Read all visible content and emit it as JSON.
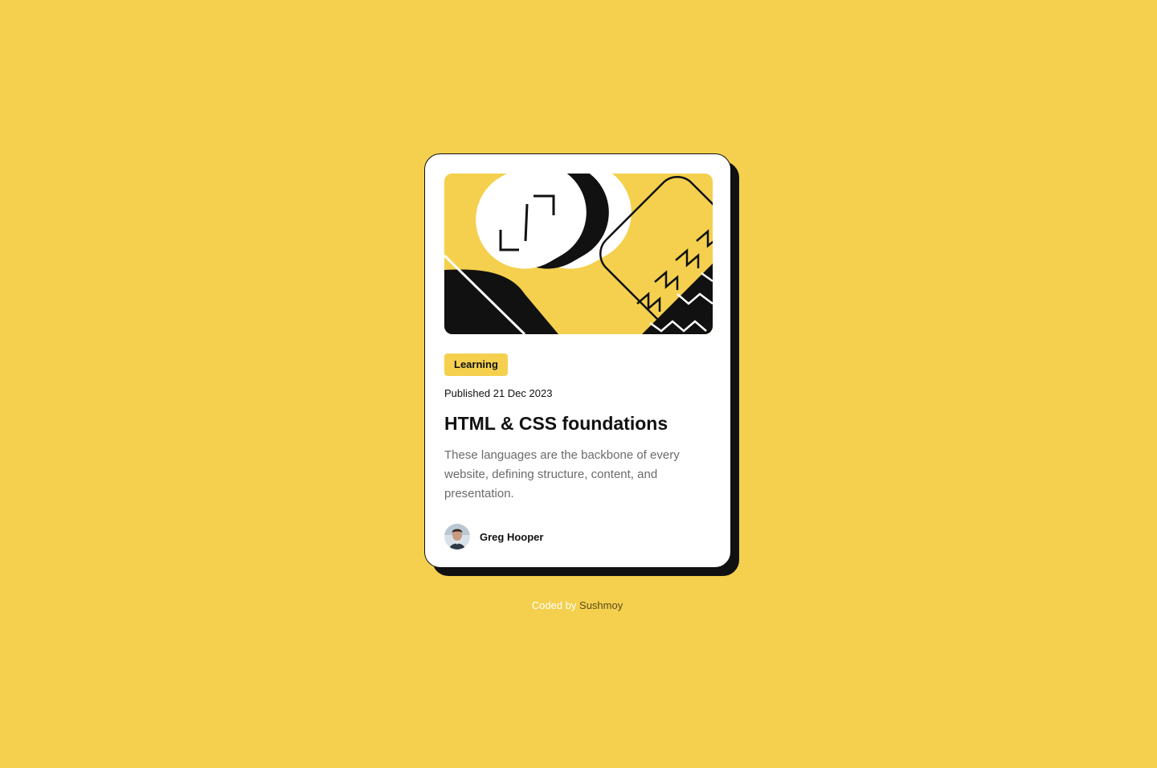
{
  "card": {
    "category": "Learning",
    "published": "Published 21 Dec 2023",
    "title": "HTML & CSS foundations",
    "description": "These languages are the backbone of every website, defining structure, content, and presentation.",
    "author": {
      "name": "Greg Hooper"
    },
    "illustration": "html-css-hero-illustration"
  },
  "footer": {
    "prefix": "Coded by",
    "author": "Sushmoy"
  },
  "colors": {
    "background": "#F4D04E",
    "card": "#FFFFFF",
    "ink": "#111111",
    "muted": "#6B6B6B"
  }
}
